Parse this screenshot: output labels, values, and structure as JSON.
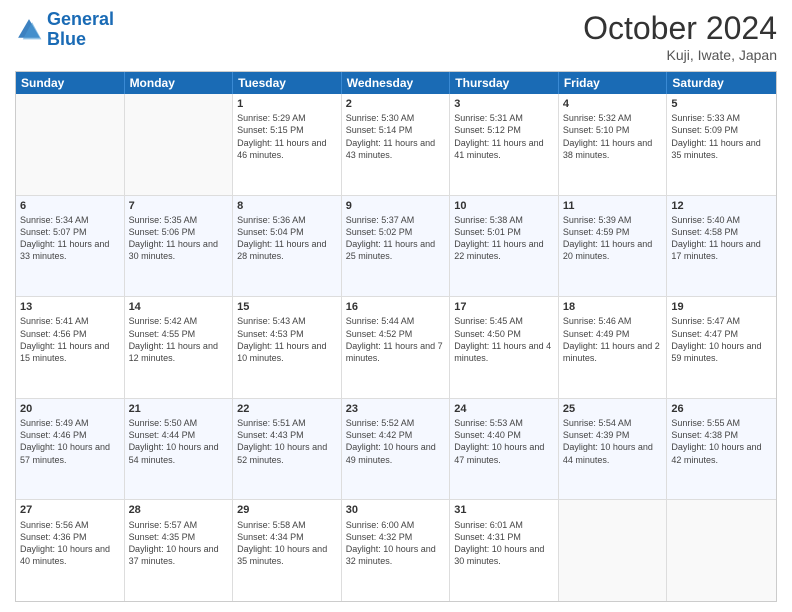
{
  "header": {
    "logo_line1": "General",
    "logo_line2": "Blue",
    "month": "October 2024",
    "location": "Kuji, Iwate, Japan"
  },
  "weekdays": [
    "Sunday",
    "Monday",
    "Tuesday",
    "Wednesday",
    "Thursday",
    "Friday",
    "Saturday"
  ],
  "rows": [
    [
      {
        "day": "",
        "info": ""
      },
      {
        "day": "",
        "info": ""
      },
      {
        "day": "1",
        "info": "Sunrise: 5:29 AM\nSunset: 5:15 PM\nDaylight: 11 hours and 46 minutes."
      },
      {
        "day": "2",
        "info": "Sunrise: 5:30 AM\nSunset: 5:14 PM\nDaylight: 11 hours and 43 minutes."
      },
      {
        "day": "3",
        "info": "Sunrise: 5:31 AM\nSunset: 5:12 PM\nDaylight: 11 hours and 41 minutes."
      },
      {
        "day": "4",
        "info": "Sunrise: 5:32 AM\nSunset: 5:10 PM\nDaylight: 11 hours and 38 minutes."
      },
      {
        "day": "5",
        "info": "Sunrise: 5:33 AM\nSunset: 5:09 PM\nDaylight: 11 hours and 35 minutes."
      }
    ],
    [
      {
        "day": "6",
        "info": "Sunrise: 5:34 AM\nSunset: 5:07 PM\nDaylight: 11 hours and 33 minutes."
      },
      {
        "day": "7",
        "info": "Sunrise: 5:35 AM\nSunset: 5:06 PM\nDaylight: 11 hours and 30 minutes."
      },
      {
        "day": "8",
        "info": "Sunrise: 5:36 AM\nSunset: 5:04 PM\nDaylight: 11 hours and 28 minutes."
      },
      {
        "day": "9",
        "info": "Sunrise: 5:37 AM\nSunset: 5:02 PM\nDaylight: 11 hours and 25 minutes."
      },
      {
        "day": "10",
        "info": "Sunrise: 5:38 AM\nSunset: 5:01 PM\nDaylight: 11 hours and 22 minutes."
      },
      {
        "day": "11",
        "info": "Sunrise: 5:39 AM\nSunset: 4:59 PM\nDaylight: 11 hours and 20 minutes."
      },
      {
        "day": "12",
        "info": "Sunrise: 5:40 AM\nSunset: 4:58 PM\nDaylight: 11 hours and 17 minutes."
      }
    ],
    [
      {
        "day": "13",
        "info": "Sunrise: 5:41 AM\nSunset: 4:56 PM\nDaylight: 11 hours and 15 minutes."
      },
      {
        "day": "14",
        "info": "Sunrise: 5:42 AM\nSunset: 4:55 PM\nDaylight: 11 hours and 12 minutes."
      },
      {
        "day": "15",
        "info": "Sunrise: 5:43 AM\nSunset: 4:53 PM\nDaylight: 11 hours and 10 minutes."
      },
      {
        "day": "16",
        "info": "Sunrise: 5:44 AM\nSunset: 4:52 PM\nDaylight: 11 hours and 7 minutes."
      },
      {
        "day": "17",
        "info": "Sunrise: 5:45 AM\nSunset: 4:50 PM\nDaylight: 11 hours and 4 minutes."
      },
      {
        "day": "18",
        "info": "Sunrise: 5:46 AM\nSunset: 4:49 PM\nDaylight: 11 hours and 2 minutes."
      },
      {
        "day": "19",
        "info": "Sunrise: 5:47 AM\nSunset: 4:47 PM\nDaylight: 10 hours and 59 minutes."
      }
    ],
    [
      {
        "day": "20",
        "info": "Sunrise: 5:49 AM\nSunset: 4:46 PM\nDaylight: 10 hours and 57 minutes."
      },
      {
        "day": "21",
        "info": "Sunrise: 5:50 AM\nSunset: 4:44 PM\nDaylight: 10 hours and 54 minutes."
      },
      {
        "day": "22",
        "info": "Sunrise: 5:51 AM\nSunset: 4:43 PM\nDaylight: 10 hours and 52 minutes."
      },
      {
        "day": "23",
        "info": "Sunrise: 5:52 AM\nSunset: 4:42 PM\nDaylight: 10 hours and 49 minutes."
      },
      {
        "day": "24",
        "info": "Sunrise: 5:53 AM\nSunset: 4:40 PM\nDaylight: 10 hours and 47 minutes."
      },
      {
        "day": "25",
        "info": "Sunrise: 5:54 AM\nSunset: 4:39 PM\nDaylight: 10 hours and 44 minutes."
      },
      {
        "day": "26",
        "info": "Sunrise: 5:55 AM\nSunset: 4:38 PM\nDaylight: 10 hours and 42 minutes."
      }
    ],
    [
      {
        "day": "27",
        "info": "Sunrise: 5:56 AM\nSunset: 4:36 PM\nDaylight: 10 hours and 40 minutes."
      },
      {
        "day": "28",
        "info": "Sunrise: 5:57 AM\nSunset: 4:35 PM\nDaylight: 10 hours and 37 minutes."
      },
      {
        "day": "29",
        "info": "Sunrise: 5:58 AM\nSunset: 4:34 PM\nDaylight: 10 hours and 35 minutes."
      },
      {
        "day": "30",
        "info": "Sunrise: 6:00 AM\nSunset: 4:32 PM\nDaylight: 10 hours and 32 minutes."
      },
      {
        "day": "31",
        "info": "Sunrise: 6:01 AM\nSunset: 4:31 PM\nDaylight: 10 hours and 30 minutes."
      },
      {
        "day": "",
        "info": ""
      },
      {
        "day": "",
        "info": ""
      }
    ]
  ]
}
